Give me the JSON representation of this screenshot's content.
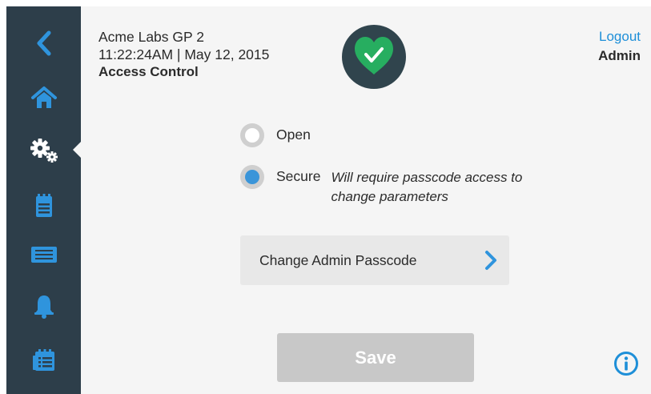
{
  "header": {
    "device_name": "Acme Labs GP 2",
    "datetime": "11:22:24AM | May 12, 2015",
    "page_title": "Access Control",
    "logout_label": "Logout",
    "user_role": "Admin"
  },
  "sidebar": {
    "items": [
      {
        "icon": "back-icon"
      },
      {
        "icon": "home-icon"
      },
      {
        "icon": "settings-gears-icon",
        "active": true
      },
      {
        "icon": "clipboard-icon"
      },
      {
        "icon": "display-panel-icon"
      },
      {
        "icon": "bell-icon"
      },
      {
        "icon": "calendar-list-icon"
      }
    ]
  },
  "access_mode": {
    "selected": "Secure",
    "options": [
      {
        "label": "Open",
        "checked": false
      },
      {
        "label": "Secure",
        "checked": true,
        "note": "Will require passcode access to change parameters"
      }
    ]
  },
  "actions": {
    "change_passcode_label": "Change Admin Passcode",
    "save_label": "Save"
  },
  "colors": {
    "sidebar": "#2d3e4a",
    "accent_blue": "#1e8fd8",
    "status_green": "#27ae60",
    "save_disabled": "#c8c8c8"
  }
}
